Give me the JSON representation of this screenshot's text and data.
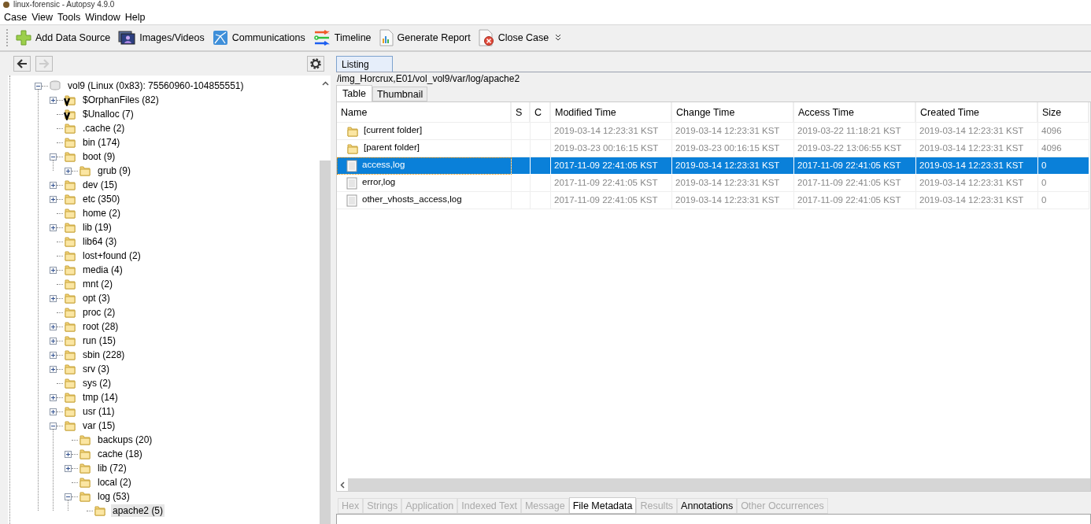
{
  "window": {
    "title": "linux-forensic - Autopsy 4.9.0"
  },
  "menu": [
    "Case",
    "View",
    "Tools",
    "Window",
    "Help"
  ],
  "toolbar": [
    {
      "kind": "add",
      "label": "Add Data Source"
    },
    {
      "kind": "images",
      "label": "Images/Videos"
    },
    {
      "kind": "communications",
      "label": "Communications"
    },
    {
      "kind": "timeline",
      "label": "Timeline"
    },
    {
      "kind": "report",
      "label": "Generate Report"
    },
    {
      "kind": "close",
      "label": "Close Case"
    }
  ],
  "navigation": {
    "back_disabled": false,
    "forward_disabled": true
  },
  "tree": [
    {
      "label": "vol9 (Linux (0x83): 75560960-104855551)",
      "kind": "volume",
      "expanded": true,
      "selected": false,
      "children": [
        {
          "label": "$OrphanFiles (82)",
          "kind": "virtual",
          "expanded": false,
          "selected": false
        },
        {
          "label": "$Unalloc (7)",
          "kind": "virtual",
          "selected": false
        },
        {
          "label": ".cache (2)",
          "kind": "folder",
          "selected": false
        },
        {
          "label": "bin (174)",
          "kind": "folder",
          "selected": false
        },
        {
          "label": "boot (9)",
          "kind": "folder",
          "expanded": true,
          "selected": false,
          "children": [
            {
              "label": "grub (9)",
              "kind": "folder",
              "expanded": false,
              "selected": false
            }
          ]
        },
        {
          "label": "dev (15)",
          "kind": "folder",
          "expanded": false,
          "selected": false
        },
        {
          "label": "etc (350)",
          "kind": "folder",
          "expanded": false,
          "selected": false
        },
        {
          "label": "home (2)",
          "kind": "folder",
          "selected": false
        },
        {
          "label": "lib (19)",
          "kind": "folder",
          "expanded": false,
          "selected": false
        },
        {
          "label": "lib64 (3)",
          "kind": "folder",
          "selected": false
        },
        {
          "label": "lost+found (2)",
          "kind": "folder",
          "selected": false
        },
        {
          "label": "media (4)",
          "kind": "folder",
          "expanded": false,
          "selected": false
        },
        {
          "label": "mnt (2)",
          "kind": "folder",
          "selected": false
        },
        {
          "label": "opt (3)",
          "kind": "folder",
          "expanded": false,
          "selected": false
        },
        {
          "label": "proc (2)",
          "kind": "folder",
          "selected": false
        },
        {
          "label": "root (28)",
          "kind": "folder",
          "expanded": false,
          "selected": false
        },
        {
          "label": "run (15)",
          "kind": "folder",
          "expanded": false,
          "selected": false
        },
        {
          "label": "sbin (228)",
          "kind": "folder",
          "expanded": false,
          "selected": false
        },
        {
          "label": "srv (3)",
          "kind": "folder",
          "expanded": false,
          "selected": false
        },
        {
          "label": "sys (2)",
          "kind": "folder",
          "selected": false
        },
        {
          "label": "tmp (14)",
          "kind": "folder",
          "expanded": false,
          "selected": false
        },
        {
          "label": "usr (11)",
          "kind": "folder",
          "expanded": false,
          "selected": false
        },
        {
          "label": "var (15)",
          "kind": "folder",
          "expanded": true,
          "selected": false,
          "children": [
            {
              "label": "backups (20)",
              "kind": "folder",
              "selected": false
            },
            {
              "label": "cache (18)",
              "kind": "folder",
              "expanded": false,
              "selected": false
            },
            {
              "label": "lib (72)",
              "kind": "folder",
              "expanded": false,
              "selected": false
            },
            {
              "label": "local (2)",
              "kind": "folder",
              "selected": false
            },
            {
              "label": "log (53)",
              "kind": "folder",
              "expanded": true,
              "selected": false,
              "children": [
                {
                  "label": "apache2 (5)",
                  "kind": "folder",
                  "selected": true
                }
              ]
            }
          ]
        }
      ]
    }
  ],
  "listing": {
    "tab": "Listing",
    "path": "/img_Horcrux,E01/vol_vol9/var/log/apache2",
    "view_tabs": [
      {
        "label": "Table",
        "selected": true
      },
      {
        "label": "Thumbnail",
        "selected": false
      }
    ],
    "table": {
      "columns": [
        "Name",
        "S",
        "C",
        "Modified Time",
        "Change Time",
        "Access Time",
        "Created Time",
        "Size"
      ],
      "rows": [
        {
          "kind": "folder",
          "selected": false,
          "cells": [
            "[current folder]",
            "",
            "",
            "2019-03-14 12:23:31 KST",
            "2019-03-14 12:23:31 KST",
            "2019-03-22 11:18:21 KST",
            "2019-03-14 12:23:31 KST",
            "4096"
          ]
        },
        {
          "kind": "folder",
          "selected": false,
          "cells": [
            "[parent folder]",
            "",
            "",
            "2019-03-23 00:16:15 KST",
            "2019-03-23 00:16:15 KST",
            "2019-03-22 13:06:55 KST",
            "2019-03-14 12:23:31 KST",
            "4096"
          ]
        },
        {
          "kind": "file",
          "selected": true,
          "cells": [
            "access,log",
            "",
            "",
            "2017-11-09 22:41:05 KST",
            "2019-03-14 12:23:31 KST",
            "2017-11-09 22:41:05 KST",
            "2019-03-14 12:23:31 KST",
            "0"
          ]
        },
        {
          "kind": "file",
          "selected": false,
          "cells": [
            "error,log",
            "",
            "",
            "2017-11-09 22:41:05 KST",
            "2019-03-14 12:23:31 KST",
            "2017-11-09 22:41:05 KST",
            "2019-03-14 12:23:31 KST",
            "0"
          ]
        },
        {
          "kind": "file",
          "selected": false,
          "cells": [
            "other_vhosts_access,log",
            "",
            "",
            "2017-11-09 22:41:05 KST",
            "2019-03-14 12:23:31 KST",
            "2017-11-09 22:41:05 KST",
            "2019-03-14 12:23:31 KST",
            "0"
          ]
        }
      ]
    }
  },
  "content_tabs": [
    {
      "label": "Hex",
      "selected": false,
      "disabled": true
    },
    {
      "label": "Strings",
      "selected": false,
      "disabled": true
    },
    {
      "label": "Application",
      "selected": false,
      "disabled": true
    },
    {
      "label": "Indexed Text",
      "selected": false,
      "disabled": true
    },
    {
      "label": "Message",
      "selected": false,
      "disabled": true
    },
    {
      "label": "File Metadata",
      "selected": true,
      "disabled": false
    },
    {
      "label": "Results",
      "selected": false,
      "disabled": true
    },
    {
      "label": "Annotations",
      "selected": false,
      "disabled": false
    },
    {
      "label": "Other Occurrences",
      "selected": false,
      "disabled": true
    }
  ]
}
